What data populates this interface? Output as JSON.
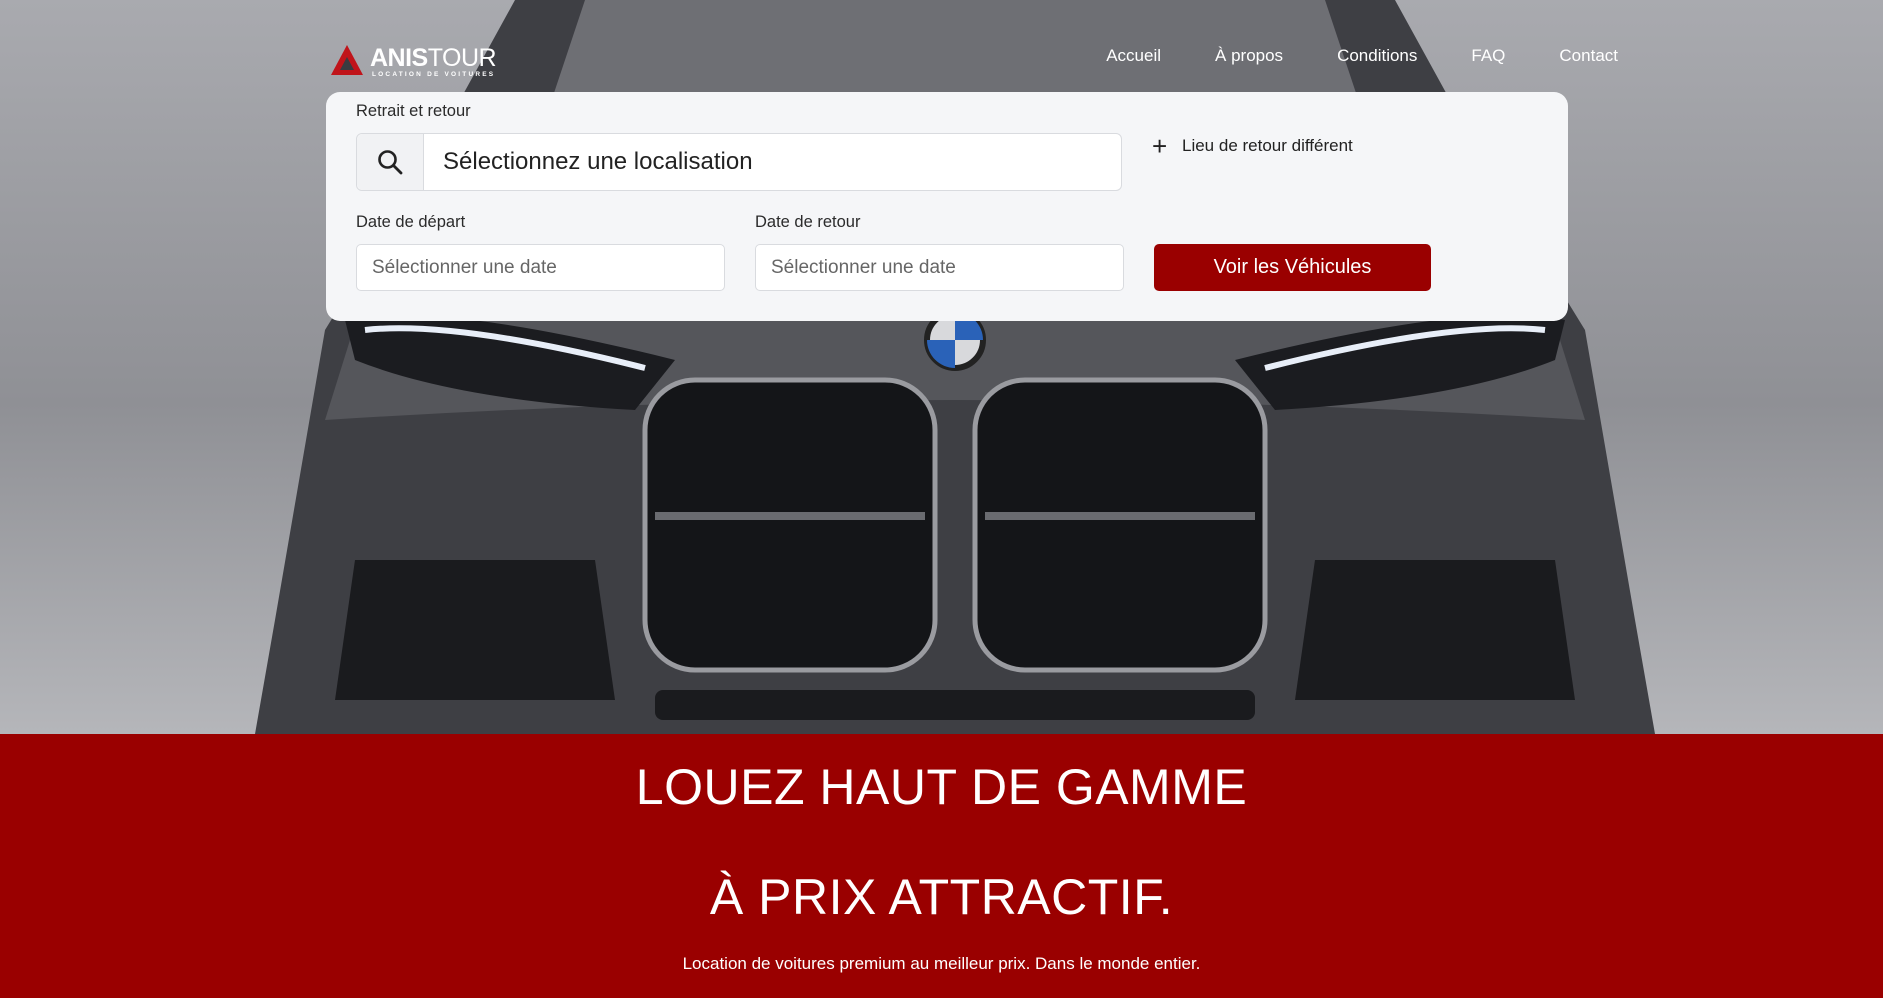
{
  "brand": {
    "name_bold": "ANIS",
    "name_light": "TOUR",
    "tagline": "LOCATION DE VOITURES",
    "accent": "#c0141a"
  },
  "nav": {
    "items": [
      "Accueil",
      "À propos",
      "Conditions",
      "FAQ",
      "Contact"
    ]
  },
  "search": {
    "location_label": "Retrait et retour",
    "location_value": "Sélectionnez une localisation",
    "different_return": "Lieu de retour différent",
    "start_label": "Date de départ",
    "start_placeholder": "Sélectionner une date",
    "end_label": "Date de retour",
    "end_placeholder": "Sélectionner une date",
    "submit": "Voir les Véhicules",
    "submit_color": "#9a0000"
  },
  "hero_text": {
    "line1": "LOUEZ HAUT DE GAMME",
    "line2": "À PRIX ATTRACTIF.",
    "subtitle": "Location de voitures premium au meilleur prix. Dans le monde entier.",
    "band_color": "#9a0000"
  },
  "icons": {
    "logo": "triangle-logo-icon",
    "search": "search-icon",
    "add": "plus-icon"
  }
}
